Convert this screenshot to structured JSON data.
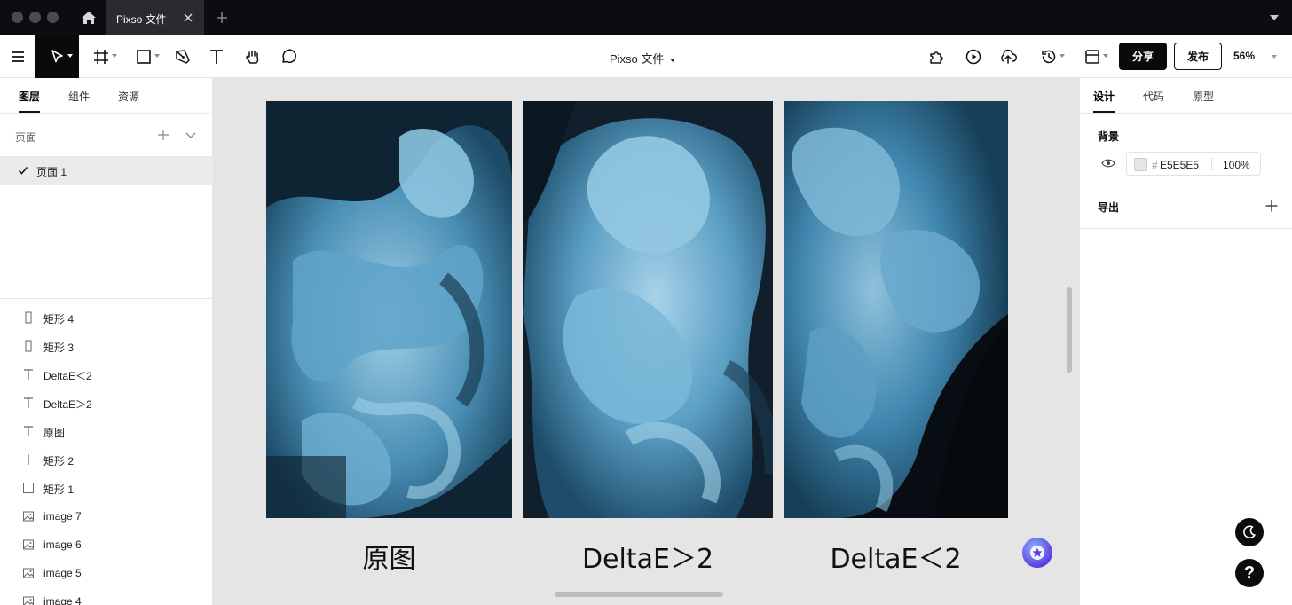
{
  "titlebar": {
    "tab_label": "Pixso 文件"
  },
  "toolbar": {
    "doc_title": "Pixso 文件",
    "share_label": "分享",
    "publish_label": "发布",
    "zoom": "56%"
  },
  "left_panel": {
    "tabs": [
      "图层",
      "组件",
      "资源"
    ],
    "pages_label": "页面",
    "current_page": "页面 1",
    "layers": [
      {
        "label": "矩形 4",
        "icon": "rect-tall-icon"
      },
      {
        "label": "矩形 3",
        "icon": "rect-tall-icon"
      },
      {
        "label": "DeltaE＜2",
        "icon": "text-icon"
      },
      {
        "label": "DeltaE＞2",
        "icon": "text-icon"
      },
      {
        "label": "原图",
        "icon": "text-icon"
      },
      {
        "label": "矩形 2",
        "icon": "line-icon"
      },
      {
        "label": "矩形 1",
        "icon": "rect-icon"
      },
      {
        "label": "image 7",
        "icon": "image-icon"
      },
      {
        "label": "image 6",
        "icon": "image-icon"
      },
      {
        "label": "image 5",
        "icon": "image-icon"
      },
      {
        "label": "image 4",
        "icon": "image-icon"
      }
    ]
  },
  "canvas": {
    "background": "#E5E5E5",
    "captions": [
      "原图",
      "DeltaE＞2",
      "DeltaE＜2"
    ]
  },
  "right_panel": {
    "tabs": [
      "设计",
      "代码",
      "原型"
    ],
    "background_title": "背景",
    "hash": "#",
    "background_hex": "E5E5E5",
    "background_opacity": "100%",
    "export_title": "导出",
    "help_label": "?"
  },
  "colors": {
    "titlebar": "#0c0c12",
    "accent_dark": "#0a0a0a",
    "ink_blue": "#4a8fb5"
  }
}
